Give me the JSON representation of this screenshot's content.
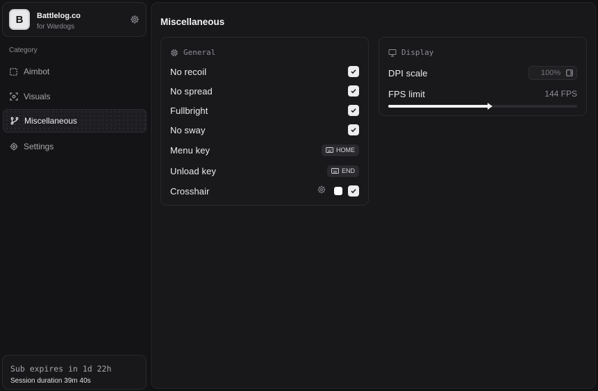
{
  "brand": {
    "logo_letter": "B",
    "name": "Battlelog.co",
    "subtitle": "for Wardogs"
  },
  "sidebar": {
    "category_label": "Category",
    "items": [
      {
        "label": "Aimbot",
        "icon": "dashed-square-icon",
        "active": false
      },
      {
        "label": "Visuals",
        "icon": "scan-eye-icon",
        "active": false
      },
      {
        "label": "Miscellaneous",
        "icon": "git-branch-icon",
        "active": true
      },
      {
        "label": "Settings",
        "icon": "gear-icon",
        "active": false
      }
    ]
  },
  "subscription": {
    "expires": "Sub expires in 1d 22h",
    "session": "Session duration 39m 40s"
  },
  "main": {
    "title": "Miscellaneous",
    "general": {
      "heading": "General",
      "rows": [
        {
          "label": "No recoil",
          "checked": true
        },
        {
          "label": "No spread",
          "checked": true
        },
        {
          "label": "Fullbright",
          "checked": true
        },
        {
          "label": "No sway",
          "checked": true
        }
      ],
      "menu_key": {
        "label": "Menu key",
        "key": "HOME"
      },
      "unload_key": {
        "label": "Unload key",
        "key": "END"
      },
      "crosshair": {
        "label": "Crosshair",
        "color": "#ffffff",
        "checked": true
      }
    },
    "display": {
      "heading": "Display",
      "dpi": {
        "label": "DPI scale",
        "value": "100%"
      },
      "fps": {
        "label": "FPS limit",
        "value": "144 FPS",
        "slider_fraction": 0.54
      }
    }
  },
  "colors": {
    "background": "#111113",
    "panel": "#18181a",
    "text": "#ececef",
    "muted": "#8e8e94"
  }
}
